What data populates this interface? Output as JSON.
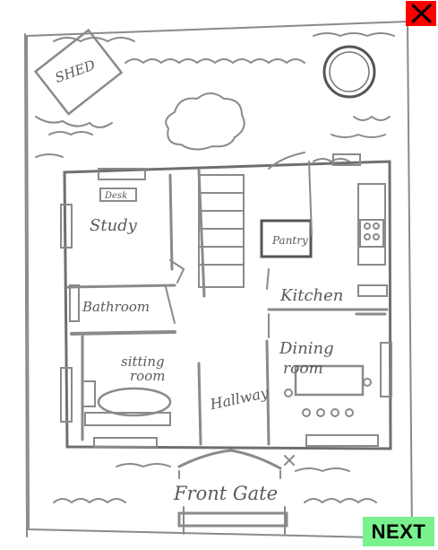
{
  "labels": {
    "shed": "SHED",
    "desk": "Desk",
    "study": "Study",
    "pantry": "Pantry",
    "kitchen": "Kitchen",
    "bathroom": "Bathroom",
    "sitting_line1": "sitting",
    "sitting_line2": "room",
    "hallway": "Hallway",
    "dining_line1": "Dining",
    "dining_line2": "room",
    "front_gate": "Front Gate"
  },
  "buttons": {
    "close_icon": "close-x-icon",
    "next": "NEXT"
  },
  "colors": {
    "close_bg": "#ff0000",
    "next_bg": "#79f28e",
    "ink": "#5a5a5a"
  }
}
